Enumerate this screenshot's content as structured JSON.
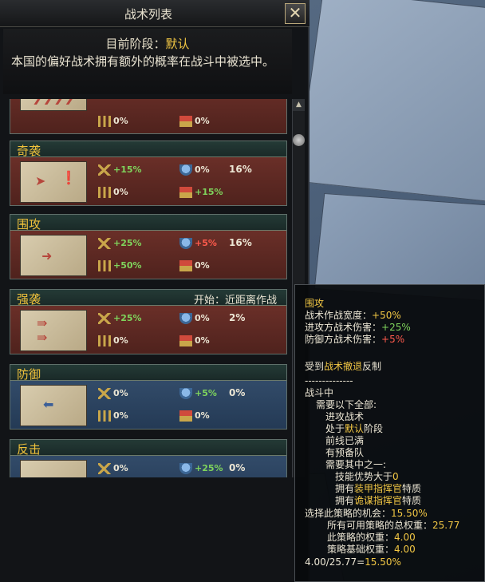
{
  "window": {
    "title": "战术列表",
    "close_label": "✕",
    "phase_label": "目前阶段：",
    "phase_value": "默认",
    "description": "本国的偏好战术拥有额外的概率在战斗中被选中。"
  },
  "tactics": [
    {
      "name": "",
      "requirement": "",
      "theme": "red",
      "attack": "",
      "defense": "",
      "speed": "0%",
      "flag": "0%",
      "chance": ""
    },
    {
      "name": "奇袭",
      "requirement": "",
      "theme": "red",
      "attack": "+15%",
      "defense": "0%",
      "speed": "0%",
      "flag": "+15%",
      "chance": "16%"
    },
    {
      "name": "围攻",
      "requirement": "",
      "theme": "red",
      "attack": "+25%",
      "defense": "+5%",
      "speed": "+50%",
      "flag": "0%",
      "chance": "16%"
    },
    {
      "name": "强袭",
      "requirement": "开始：近距离作战",
      "theme": "red",
      "attack": "+25%",
      "defense": "0%",
      "speed": "0%",
      "flag": "0%",
      "chance": "2%"
    },
    {
      "name": "防御",
      "requirement": "",
      "theme": "blue",
      "attack": "0%",
      "defense": "+5%",
      "speed": "0%",
      "flag": "0%",
      "chance": "0%"
    },
    {
      "name": "反击",
      "requirement": "",
      "theme": "blue",
      "attack": "0%",
      "defense": "+25%",
      "speed": "",
      "flag": "",
      "chance": "0%"
    }
  ],
  "tooltip": {
    "title": "围攻",
    "width_label": "战术作战宽度：",
    "width_value": "+50%",
    "atk_label": "进攻方战术伤害：",
    "atk_value": "+25%",
    "def_label": "防御方战术伤害：",
    "def_value": "+5%",
    "counter_prefix": "受到",
    "counter_name": "战术撤退",
    "counter_suffix": "反制",
    "separator": "--------------",
    "in_battle": "战斗中",
    "needs_all": "需要以下全部:",
    "cond_attack": "进攻战术",
    "cond_phase_prefix": "处于",
    "cond_phase_value": "默认",
    "cond_phase_suffix": "阶段",
    "cond_frontline": "前线已满",
    "cond_reserve": "有预备队",
    "needs_one": "需要其中之一:",
    "opt_skill_prefix": "技能优势大于",
    "opt_skill_value": "0",
    "opt_armor_prefix": "拥有",
    "opt_armor_value": "装甲指挥官",
    "opt_armor_suffix": "特质",
    "opt_trick_prefix": "拥有",
    "opt_trick_value": "诡谋指挥官",
    "opt_trick_suffix": "特质",
    "chance_label": "选择此策略的机会：",
    "chance_value": "15.50%",
    "total_label": "所有可用策略的总权重：",
    "total_value": "25.77",
    "weight_label": "此策略的权重：",
    "weight_value": "4.00",
    "base_label": "策略基础权重：",
    "base_value": "4.00",
    "formula_prefix": "4.00/25.77=",
    "formula_value": "15.50%"
  },
  "colors": {
    "accent": "#f2c744",
    "positive": "#7fd45c",
    "negative": "#ff5a4c"
  }
}
